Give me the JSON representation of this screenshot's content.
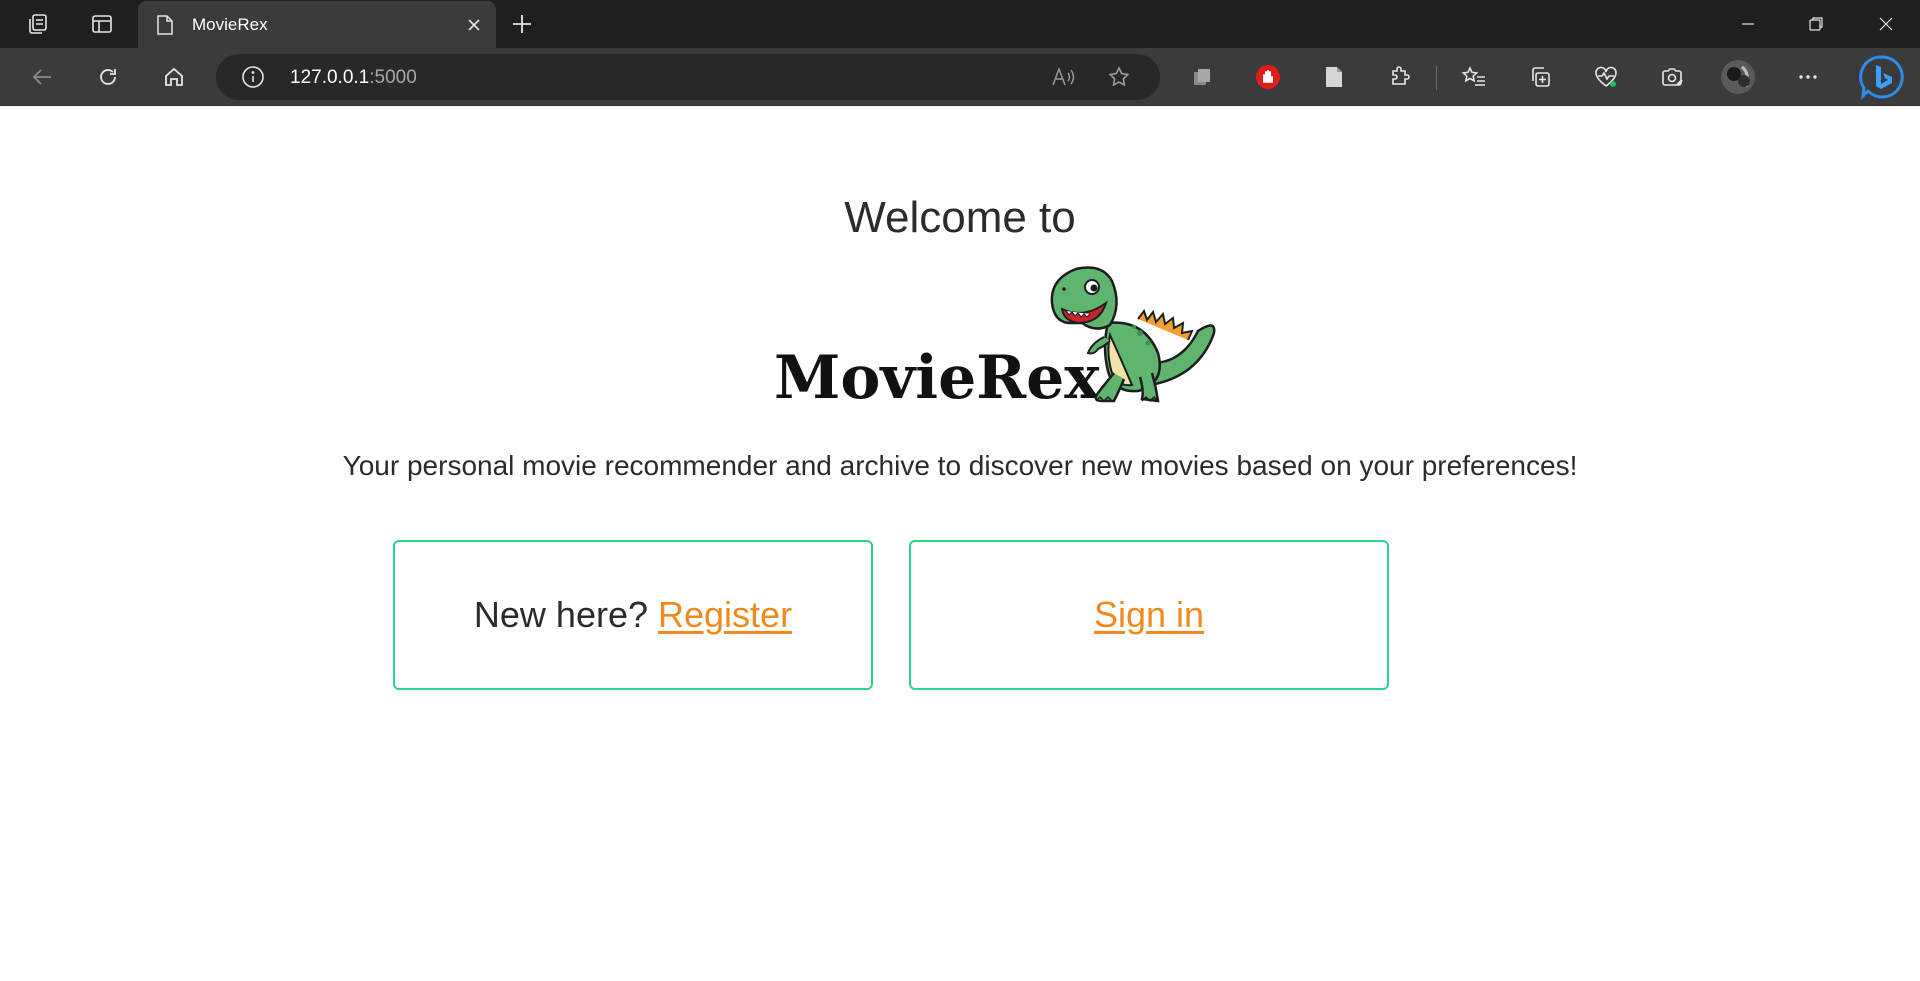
{
  "browser": {
    "tab": {
      "title": "MovieRex"
    },
    "address": {
      "host": "127.0.0.1",
      "port": ":5000"
    },
    "icons": [
      "workspaces-icon",
      "tab-actions-icon",
      "page-icon",
      "close-icon",
      "new-tab-icon",
      "minimize-icon",
      "restore-icon",
      "window-close-icon",
      "back-icon",
      "refresh-icon",
      "home-icon",
      "info-icon",
      "read-aloud-icon",
      "favorite-star-icon",
      "extension-copy-icon",
      "adblock-icon",
      "document-icon",
      "extensions-icon",
      "favorites-icon",
      "collections-icon",
      "health-icon",
      "browser-essentials-icon",
      "profile-avatar-icon",
      "more-icon",
      "bing-chat-icon"
    ]
  },
  "page": {
    "welcome": "Welcome to",
    "logo": "MovieRex",
    "tagline": "Your personal movie recommender and archive to discover new movies based on your preferences!",
    "register_card": {
      "prefix": "New here? ",
      "link": "Register"
    },
    "signin_card": {
      "link": "Sign in"
    }
  },
  "colors": {
    "accent_link": "#f08a1e",
    "card_border": "#2bd48a",
    "chrome_dark": "#1f1f1f",
    "chrome_toolbar": "#3b3b3b"
  }
}
